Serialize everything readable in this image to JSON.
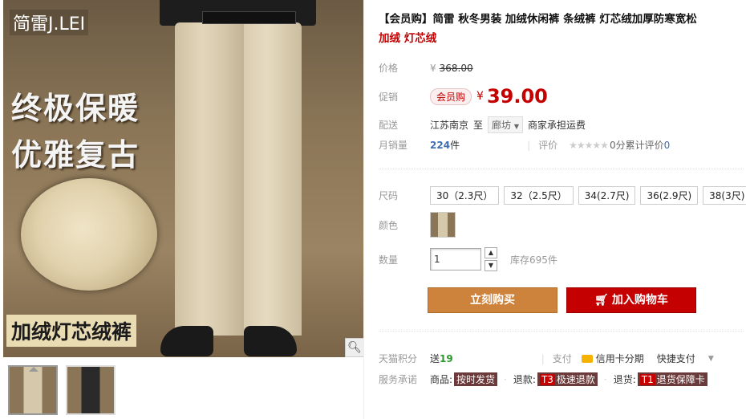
{
  "gallery": {
    "brand": "简雷J.LEI",
    "slogan_line1": "终极保暖",
    "slogan_line2": "优雅复古",
    "bottom_banner": "加绒灯芯绒裤",
    "zoom_icon": "search-icon"
  },
  "title": {
    "main": "【会员购】简雷 秋冬男装 加绒休闲裤 条绒裤 灯芯绒加厚防寒宽松",
    "highlight": "加绒 灯芯绒"
  },
  "price": {
    "label": "价格",
    "yen": "¥",
    "original": "368.00"
  },
  "promo": {
    "label": "促销",
    "badge": "会员购",
    "yen": "¥",
    "value": "39.00"
  },
  "delivery": {
    "label": "配送",
    "from": "江苏南京",
    "to_word": "至",
    "destination": "廊坊",
    "note": "商家承担运费"
  },
  "sales": {
    "label": "月销量",
    "count": "224",
    "unit": "件",
    "rating_label": "评价",
    "stars": "★★★★★",
    "rating_text": "0分累计评价",
    "review_count": "0"
  },
  "size": {
    "label": "尺码",
    "options": [
      "30（2.3尺）",
      "32（2.5尺）",
      "34(2.7尺)",
      "36(2.9尺)",
      "38(3尺)"
    ]
  },
  "color": {
    "label": "颜色"
  },
  "quantity": {
    "label": "数量",
    "value": "1",
    "stock": "库存695件"
  },
  "buttons": {
    "buy_now": "立刻购买",
    "add_to_cart": "加入购物车"
  },
  "points": {
    "label": "天猫积分",
    "send": "送",
    "value": "19",
    "pay_label": "支付",
    "credit_card": "信用卡分期",
    "quick_pay": "快捷支付"
  },
  "service": {
    "label": "服务承诺",
    "goods_label": "商品:",
    "goods_tag": "按时发货",
    "refund_label": "退款:",
    "refund_tag_prefix": "T3",
    "refund_tag": "极速退款",
    "return_label": "退货:",
    "return_tag_prefix": "T1",
    "return_tag": "退货保障卡"
  },
  "colors": {
    "accent_red": "#c40000",
    "buy_orange": "#cd833b",
    "points_green": "#2a9b2a"
  }
}
